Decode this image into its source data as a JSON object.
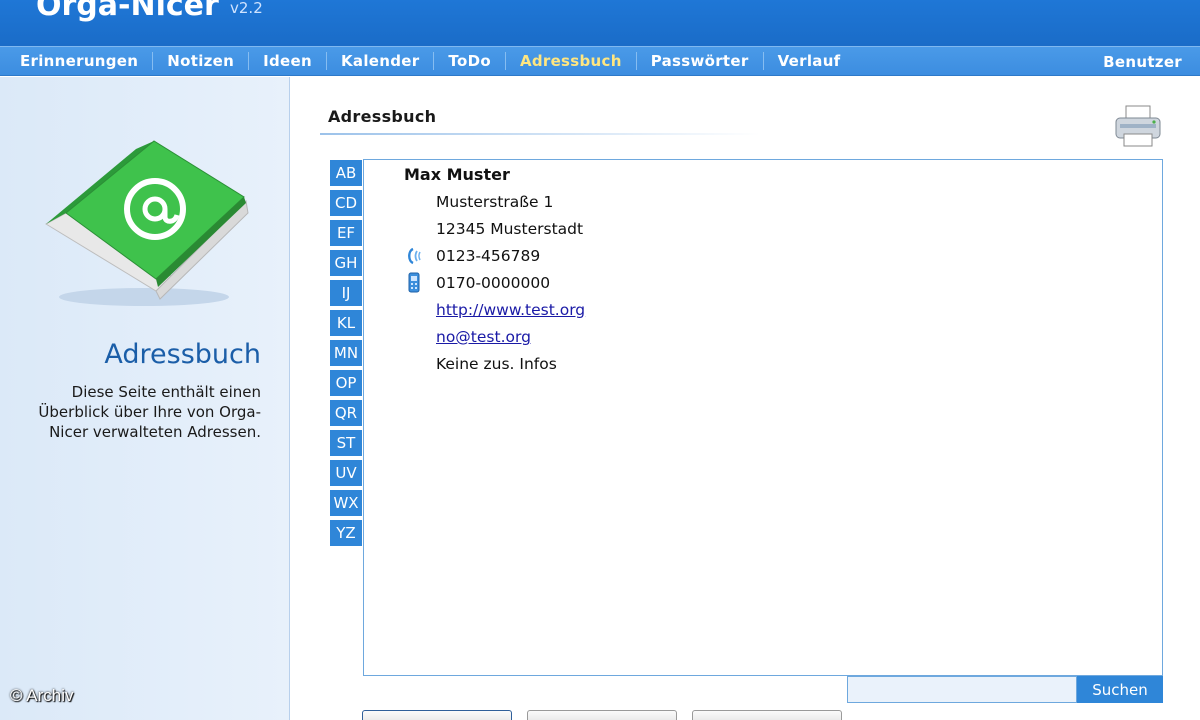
{
  "header": {
    "app_name": "Orga-Nicer",
    "version": "v2.2"
  },
  "nav": {
    "items": [
      {
        "label": "Erinnerungen"
      },
      {
        "label": "Notizen"
      },
      {
        "label": "Ideen"
      },
      {
        "label": "Kalender"
      },
      {
        "label": "ToDo"
      },
      {
        "label": "Adressbuch",
        "active": true
      },
      {
        "label": "Passwörter"
      },
      {
        "label": "Verlauf"
      }
    ],
    "user_label": "Benutzer"
  },
  "sidebar": {
    "icon": "address-book-icon",
    "title": "Adressbuch",
    "description": "Diese Seite enthält einen Überblick über Ihre von Orga-Nicer verwalteten Adressen."
  },
  "main": {
    "title": "Adressbuch",
    "print_icon": "printer-icon",
    "alpha_tabs": [
      "AB",
      "CD",
      "EF",
      "GH",
      "IJ",
      "KL",
      "MN",
      "OP",
      "QR",
      "ST",
      "UV",
      "WX",
      "YZ"
    ],
    "contact": {
      "name": "Max Muster",
      "street": "Musterstraße 1",
      "city": "12345 Musterstadt",
      "phone": "0123-456789",
      "mobile": "0170-0000000",
      "website": "http://www.test.org",
      "email": "no@test.org",
      "info": "Keine zus. Infos"
    },
    "search": {
      "value": "",
      "button_label": "Suchen"
    }
  },
  "watermark": "© Archiv",
  "colors": {
    "header_blue": "#1a6cc8",
    "nav_blue": "#3c8de0",
    "active_nav": "#ffe680",
    "tab_blue": "#2f86d8",
    "link": "#1a1aa6"
  }
}
